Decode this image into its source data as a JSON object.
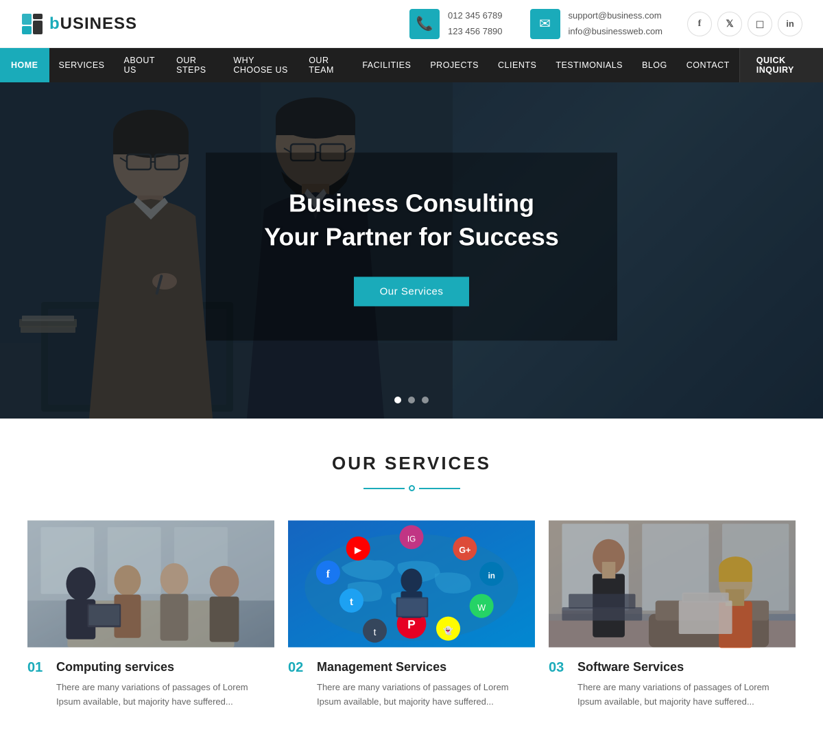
{
  "logo": {
    "letter": "b",
    "text": "USINESS",
    "full": "bUSINESS"
  },
  "topbar": {
    "phone1": "012 345 6789",
    "phone2": "123 456 7890",
    "email1": "support@business.com",
    "email2": "info@businessweb.com"
  },
  "social": {
    "facebook": "f",
    "twitter": "t",
    "instagram": "in",
    "linkedin": "li"
  },
  "nav": {
    "items": [
      {
        "label": "HOME",
        "active": true
      },
      {
        "label": "SERVICES",
        "active": false
      },
      {
        "label": "ABOUT US",
        "active": false
      },
      {
        "label": "OUR STEPS",
        "active": false
      },
      {
        "label": "WHY CHOOSE US",
        "active": false
      },
      {
        "label": "OUR TEAM",
        "active": false
      },
      {
        "label": "FACILITIES",
        "active": false
      },
      {
        "label": "PROJECTS",
        "active": false
      },
      {
        "label": "CLIENTS",
        "active": false
      },
      {
        "label": "TESTIMONIALS",
        "active": false
      },
      {
        "label": "BLOG",
        "active": false
      },
      {
        "label": "CONTACT",
        "active": false
      }
    ],
    "quick_inquiry": "QUICK INQUIRY"
  },
  "hero": {
    "title": "Business Consulting Your Partner for Success",
    "cta": "Our Services",
    "dots": [
      1,
      2,
      3
    ]
  },
  "services_section": {
    "title": "OUR SERVICES",
    "cards": [
      {
        "number": "01",
        "name": "Computing services",
        "desc": "There are many variations of passages of Lorem Ipsum available, but majority have suffered..."
      },
      {
        "number": "02",
        "name": "Management Services",
        "desc": "There are many variations of passages of Lorem Ipsum available, but majority have suffered..."
      },
      {
        "number": "03",
        "name": "Software Services",
        "desc": "There are many variations of passages of Lorem Ipsum available, but majority have suffered..."
      }
    ]
  },
  "colors": {
    "accent": "#1aabba",
    "dark": "#1f1f1f",
    "text": "#222222",
    "muted": "#666666"
  }
}
